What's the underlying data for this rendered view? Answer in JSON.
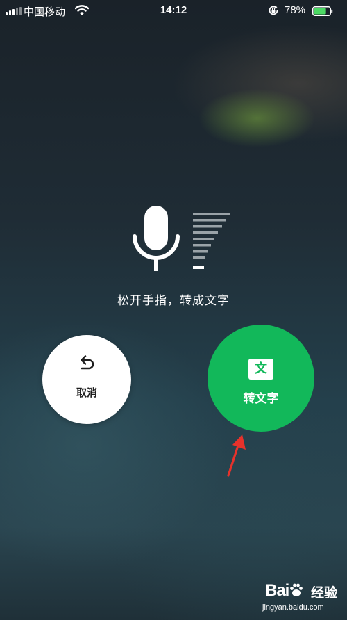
{
  "status_bar": {
    "carrier": "中国移动",
    "time": "14:12",
    "battery_percent": "78%",
    "battery_level": 0.78,
    "battery_color": "#4cd964"
  },
  "voice": {
    "hint": "松开手指，转成文字",
    "mic_icon": "microphone-icon",
    "meter_icon": "volume-level-icon"
  },
  "actions": {
    "cancel_label": "取消",
    "cancel_icon": "undo-icon",
    "convert_label": "转文字",
    "convert_badge": "文",
    "convert_color": "#12b85a"
  },
  "annotation": {
    "arrow_color": "#e8322b"
  },
  "watermark": {
    "logo": "Bai",
    "logo_suffix": "经验",
    "url": "jingyan.baidu.com"
  }
}
